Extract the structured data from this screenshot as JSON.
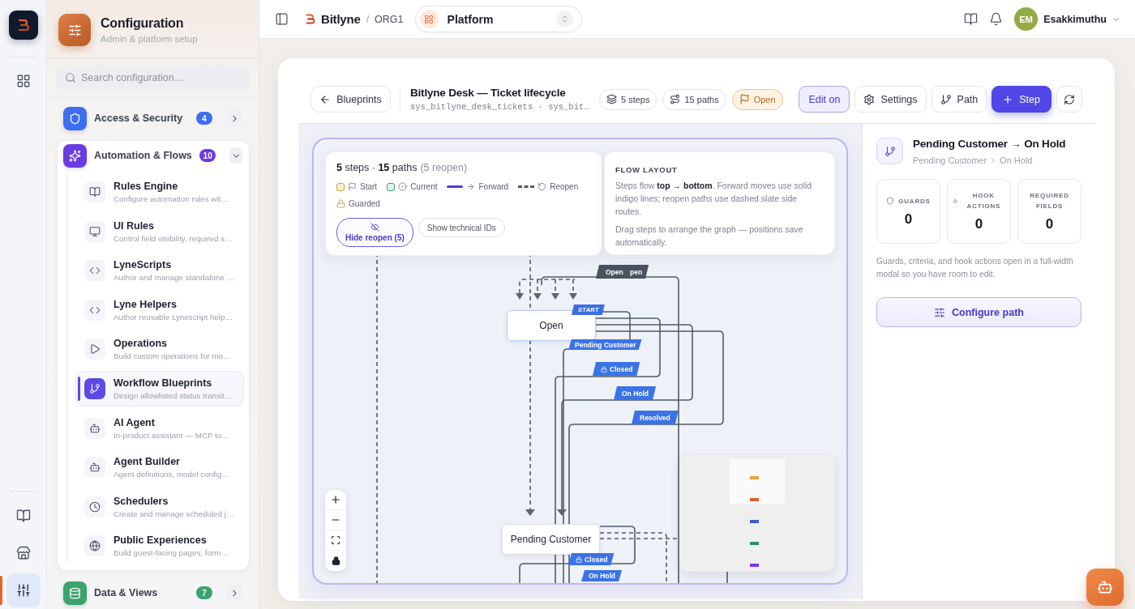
{
  "rail": {
    "top_items": [
      {
        "selected": false
      }
    ],
    "bottom_items": [
      {
        "selected": false
      },
      {
        "selected": false
      },
      {
        "selected": true
      }
    ]
  },
  "config": {
    "title": "Configuration",
    "subtitle": "Admin & platform setup",
    "search": {
      "placeholder": "Search configuration…"
    },
    "sections": [
      {
        "label": "Access & Security",
        "count": "4",
        "color": "#3d6ef0",
        "expanded": false
      },
      {
        "label": "Automation & Flows",
        "count": "10",
        "color": "#6a3be0",
        "expanded": true,
        "items": [
          {
            "title": "Rules Engine",
            "description": "Configure automation rules wit…",
            "selected": false
          },
          {
            "title": "UI Rules",
            "description": "Control field visibility, required s…",
            "selected": false
          },
          {
            "title": "LyneScripts",
            "description": "Author and manage standalone …",
            "selected": false
          },
          {
            "title": "Lyne Helpers",
            "description": "Author reusable Lynescript help…",
            "selected": false
          },
          {
            "title": "Operations",
            "description": "Build custom operations for mo…",
            "selected": false
          },
          {
            "title": "Workflow Blueprints",
            "description": "Design allowlisted status transit…",
            "selected": true
          },
          {
            "title": "AI Agent",
            "description": "In-product assistant — MCP to…",
            "selected": false
          },
          {
            "title": "Agent Builder",
            "description": "Agent definitions, model config…",
            "selected": false
          },
          {
            "title": "Schedulers",
            "description": "Create and manage scheduled j…",
            "selected": false
          },
          {
            "title": "Public Experiences",
            "description": "Build guest-facing pages, form…",
            "selected": false
          }
        ]
      },
      {
        "label": "Data & Views",
        "count": "7",
        "color": "#3ba36d",
        "expanded": false
      }
    ]
  },
  "topbar": {
    "brand": "Bitlyne",
    "separator": "/",
    "org": "ORG1",
    "workspace": "Platform",
    "user": {
      "initials": "EM",
      "name": "Esakkimuthu"
    }
  },
  "blueprint": {
    "back": "Blueprints",
    "title": "Bitlyne Desk — Ticket lifecycle",
    "tables": "sys_bitlyne_desk_tickets · sys_bit…",
    "chips": [
      {
        "kind": "steps",
        "label": "5 steps"
      },
      {
        "kind": "paths",
        "label": "15 paths"
      },
      {
        "kind": "status",
        "label": "Open"
      }
    ],
    "actions": [
      {
        "kind": "toggle",
        "label": "Edit on",
        "on": true
      },
      {
        "kind": "settings",
        "label": "Settings"
      },
      {
        "kind": "path",
        "label": "Path"
      },
      {
        "kind": "primary",
        "label": "Step"
      },
      {
        "kind": "refresh"
      }
    ]
  },
  "canvas": {
    "summary": "**5** steps · **15** paths",
    "reopen_note": "(5 reopen)",
    "legend": [
      {
        "kind": "start",
        "label": "Start"
      },
      {
        "kind": "current",
        "label": "Current"
      },
      {
        "kind": "forward",
        "label": "Forward"
      },
      {
        "kind": "reopen",
        "label": "Reopen"
      },
      {
        "kind": "guarded",
        "label": "Guarded"
      }
    ],
    "toggles": [
      {
        "kind": "reopen",
        "label": "Hide reopen (5)",
        "selected": true
      },
      {
        "kind": "ids",
        "label": "Show technical IDs",
        "selected": false
      }
    ],
    "layout_help": {
      "heading": "FLOW LAYOUT",
      "paragraphs": [
        "Steps flow **top → bottom**. Forward moves use solid indigo lines; reopen paths use dashed slate side routes.",
        "Drag steps to arrange the graph — positions save automatically."
      ]
    },
    "nodes": [
      {
        "label": "Open",
        "start": true,
        "tag": "START"
      },
      {
        "label": "Pending Customer",
        "start": false
      }
    ],
    "edges": [
      {
        "kind": "reopen",
        "label": "Open",
        "guarded": false
      },
      {
        "kind": "reopen",
        "label": "pen",
        "guarded": false
      },
      {
        "kind": "forward",
        "label": "Pending Customer",
        "guarded": false
      },
      {
        "kind": "forward",
        "label": "Closed",
        "guarded": true
      },
      {
        "kind": "forward",
        "label": "On Hold",
        "guarded": false
      },
      {
        "kind": "forward",
        "label": "Resolved",
        "guarded": false
      },
      {
        "kind": "forward",
        "label": "Closed",
        "guarded": true
      },
      {
        "kind": "forward",
        "label": "On Hold",
        "guarded": false
      }
    ]
  },
  "path_panel": {
    "title": "Pending Customer → On Hold",
    "from": "Pending Customer",
    "to": "On Hold",
    "stats": [
      {
        "kind": "guards",
        "label": "GUARDS",
        "value": "0"
      },
      {
        "kind": "hooks",
        "label": "HOOK ACTIONS",
        "value": "0"
      },
      {
        "kind": "fields",
        "label": "REQUIRED FIELDS",
        "value": "0"
      }
    ],
    "note": "Guards, criteria, and hook actions open in a full-width modal so you have room to edit.",
    "button": "Configure path"
  }
}
